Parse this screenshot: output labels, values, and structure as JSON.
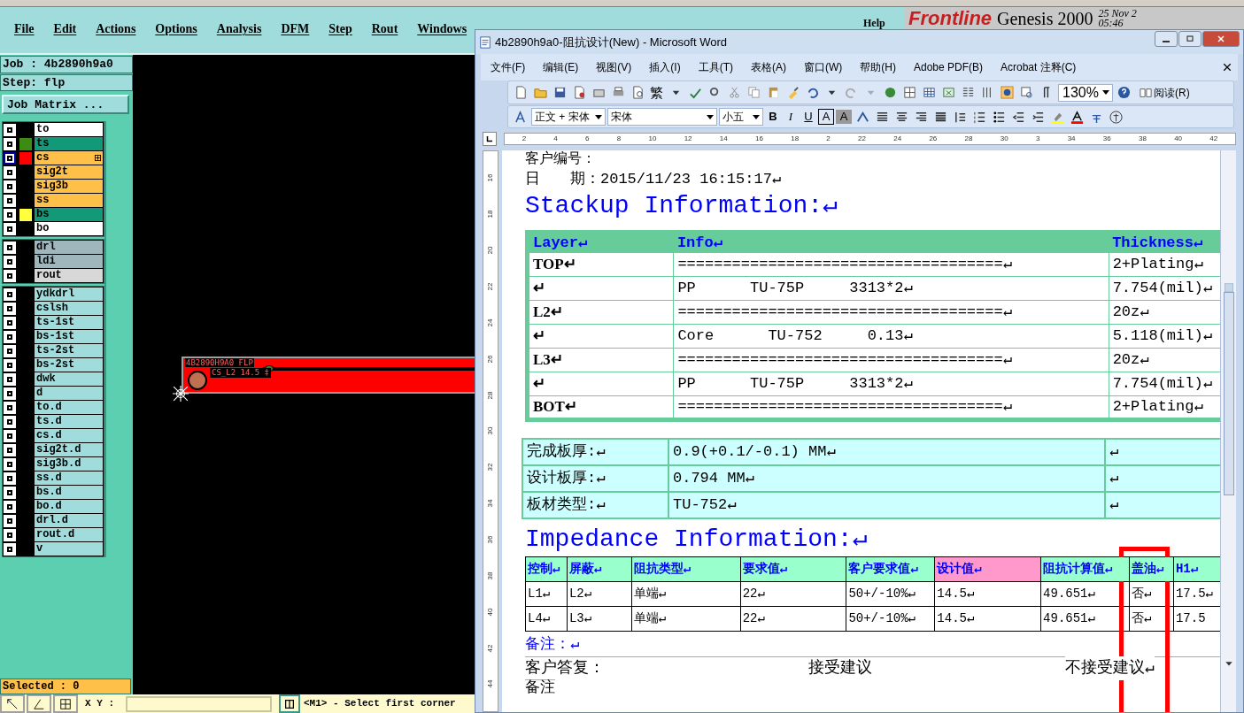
{
  "genesis": {
    "menu": [
      "File",
      "Edit",
      "Actions",
      "Options",
      "Analysis",
      "DFM",
      "Step",
      "Rout",
      "Windows"
    ],
    "help": "Help",
    "logo": "Frontline",
    "product": "Genesis 2000",
    "date": "25 Nov 2",
    "time": "05:46",
    "job": "Job : 4b2890h9a0",
    "step": "Step: flp",
    "job_matrix_button": "Job Matrix ...",
    "layer_groups": [
      [
        {
          "name": "to",
          "color": "#ffffff",
          "active": false
        },
        {
          "name": "ts",
          "color": "#129a78",
          "active": false,
          "swatch": {
            "color": "#3c8c14"
          }
        },
        {
          "name": "cs",
          "color": "#ffc04a",
          "active": true,
          "swatch": {
            "color": "#ff0000"
          }
        },
        {
          "name": "sig2t",
          "color": "#ffc04a",
          "active": false
        },
        {
          "name": "sig3b",
          "color": "#ffc04a",
          "active": false
        },
        {
          "name": "ss",
          "color": "#ffc04a",
          "active": false
        },
        {
          "name": "bs",
          "color": "#129a78",
          "active": false,
          "swatch": {
            "color": "#ffff40"
          }
        },
        {
          "name": "bo",
          "color": "#ffffff",
          "active": false
        }
      ],
      [
        {
          "name": "drl",
          "color": "#9fb6bc",
          "active": false
        },
        {
          "name": "ldi",
          "color": "#9fb6bc",
          "active": false
        },
        {
          "name": "rout",
          "color": "#d8d8d8",
          "active": false
        }
      ],
      [
        {
          "name": "ydkdrl",
          "color": "#a0dcdc",
          "active": false
        },
        {
          "name": "cslsh",
          "color": "#a0dcdc",
          "active": false
        },
        {
          "name": "ts-1st",
          "color": "#a0dcdc",
          "active": false
        },
        {
          "name": "bs-1st",
          "color": "#a0dcdc",
          "active": false
        },
        {
          "name": "ts-2st",
          "color": "#a0dcdc",
          "active": false
        },
        {
          "name": "bs-2st",
          "color": "#a0dcdc",
          "active": false
        },
        {
          "name": "dwk",
          "color": "#a0dcdc",
          "active": false
        },
        {
          "name": "d",
          "color": "#a0dcdc",
          "active": false
        },
        {
          "name": "to.d",
          "color": "#a0dcdc",
          "active": false
        },
        {
          "name": "ts.d",
          "color": "#a0dcdc",
          "active": false
        },
        {
          "name": "cs.d",
          "color": "#a0dcdc",
          "active": false
        },
        {
          "name": "sig2t.d",
          "color": "#a0dcdc",
          "active": false
        },
        {
          "name": "sig3b.d",
          "color": "#a0dcdc",
          "active": false
        },
        {
          "name": "ss.d",
          "color": "#a0dcdc",
          "active": false
        },
        {
          "name": "bs.d",
          "color": "#a0dcdc",
          "active": false
        },
        {
          "name": "bo.d",
          "color": "#a0dcdc",
          "active": false
        },
        {
          "name": "drl.d",
          "color": "#a0dcdc",
          "active": false
        },
        {
          "name": "rout.d",
          "color": "#a0dcdc",
          "active": false
        },
        {
          "name": "v",
          "color": "#a0dcdc",
          "active": false
        }
      ]
    ],
    "board_label": "4B2890H9A0 FLP",
    "trace_label": "CS_L2 14.5 ‡",
    "selected_count": "Selected : 0",
    "xy_label": "X Y :",
    "status": "<M1> - Select first corner"
  },
  "word": {
    "title": "4b2890h9a0-阻抗设计(New) - Microsoft Word",
    "menu": [
      "文件(F)",
      "编辑(E)",
      "视图(V)",
      "插入(I)",
      "工具(T)",
      "表格(A)",
      "窗口(W)",
      "帮助(H)",
      "Adobe PDF(B)",
      "Acrobat 注释(C)"
    ],
    "trad_button": "繁",
    "zoom": "130%",
    "read_button": "阅读(R)",
    "style": "正文 + 宋体",
    "font": "宋体",
    "size": "小五",
    "format_buttons": [
      "B",
      "I",
      "U",
      "A",
      "A"
    ],
    "ruler": [
      "2",
      "4",
      "6",
      "8",
      "10",
      "12",
      "14",
      "16",
      "18",
      "2",
      "22",
      "24",
      "26",
      "28",
      "30",
      "3",
      "34",
      "36",
      "38",
      "40",
      "42"
    ],
    "vruler": [
      "16",
      "18",
      "20",
      "22",
      "24",
      "26",
      "28",
      "30",
      "32",
      "34",
      "36",
      "38",
      "40",
      "42",
      "44"
    ],
    "doc": {
      "customer_no": "客户编号：",
      "date": "日　　期：2015/11/23 16:15:17↵",
      "stackup_heading": "Stackup Information:↵",
      "stackup": {
        "columns": [
          "Layer↵",
          "Info↵",
          "Thickness↵"
        ],
        "rows": [
          [
            "TOP↵",
            "====================================↵",
            "2+Plating↵"
          ],
          [
            "↵",
            "PP      TU-75P     3313*2↵",
            "7.754(mil)↵"
          ],
          [
            "L2↵",
            "====================================↵",
            "20z↵"
          ],
          [
            "↵",
            "Core      TU-752     0.13↵",
            "5.118(mil)↵"
          ],
          [
            "L3↵",
            "====================================↵",
            "20z↵"
          ],
          [
            "↵",
            "PP      TU-75P     3313*2↵",
            "7.754(mil)↵"
          ],
          [
            "BOT↵",
            "====================================↵",
            "2+Plating↵"
          ]
        ]
      },
      "board_rows": [
        [
          "完成板厚:↵",
          "0.9(+0.1/-0.1) MM↵",
          "↵"
        ],
        [
          "设计板厚:↵",
          "0.794 MM↵",
          "↵"
        ],
        [
          "板材类型:↵",
          "TU-752↵",
          "↵"
        ]
      ],
      "impedance_heading": "Impedance Information:↵",
      "impedance": {
        "columns": [
          {
            "label": "控制↵",
            "color": "#99ffcc"
          },
          {
            "label": "屏蔽↵",
            "color": "#99ffcc"
          },
          {
            "label": "阻抗类型↵",
            "color": "#99ffcc"
          },
          {
            "label": "要求值↵",
            "color": "#99ffcc"
          },
          {
            "label": "客户要求值↵",
            "color": "#99ffcc"
          },
          {
            "label": "设计值↵",
            "color": "#ff99cc"
          },
          {
            "label": "阻抗计算值↵",
            "color": "#99ffcc"
          },
          {
            "label": "盖油↵",
            "color": "#99ffcc"
          },
          {
            "label": "H1↵",
            "color": "#99ffcc"
          }
        ],
        "rows": [
          [
            "L1↵",
            "L2↵",
            "单端↵",
            "22↵",
            "50+/-10%↵",
            "14.5↵",
            "49.651↵",
            "否↵",
            "17.5↵"
          ],
          [
            "L4↵",
            "L3↵",
            "单端↵",
            "22↵",
            "50+/-10%↵",
            "14.5↵",
            "49.651↵",
            "否↵",
            "17.5"
          ]
        ]
      },
      "remark": "备注：↵",
      "reply_label": "客户答复：",
      "accept": "接受建议",
      "reject": "不接受建议↵",
      "remark2": "备注"
    }
  }
}
